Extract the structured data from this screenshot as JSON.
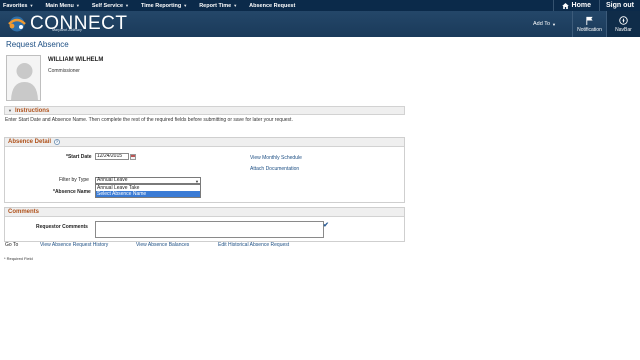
{
  "topnav": {
    "items": [
      {
        "label": "Favorites"
      },
      {
        "label": "Main Menu"
      },
      {
        "label": "Self Service"
      },
      {
        "label": "Time Reporting"
      },
      {
        "label": "Report Time"
      }
    ],
    "current": "Absence Request",
    "home_label": "Home",
    "signout_label": "Sign out"
  },
  "brand": {
    "logo_text": "CONNECT",
    "logo_sub": "Maryland Judiciary",
    "addto_label": "Add To",
    "notification_label": "Notification",
    "navbar_label": "NavBar"
  },
  "page": {
    "title": "Request Absence"
  },
  "employee": {
    "name": "WILLIAM WILHELM",
    "title": "Commissioner"
  },
  "instructions": {
    "heading": "Instructions",
    "text": "Enter Start Date and Absence Name. Then complete the rest of the required fields before submitting or save for later your request."
  },
  "absence_detail": {
    "heading": "Absence Detail",
    "start_date_label": "*Start Date",
    "start_date_value": "12/24/2015",
    "filter_label": "Filter by Type",
    "filter_value": "Annual Leave",
    "absence_name_label": "*Absence Name",
    "dropdown_options": [
      "Annual Leave Take",
      "Select Absence Name"
    ],
    "selected_option_index": 1,
    "link_schedule": "View Monthly Schedule",
    "link_attach": "Attach Documentation"
  },
  "comments": {
    "heading": "Comments",
    "requestor_label": "Requestor Comments",
    "requestor_value": ""
  },
  "goto": {
    "label": "Go To",
    "links": [
      "View Absence Request History",
      "View Absence Balances",
      "Edit Historical Absence Request"
    ]
  },
  "required_note": "* Required Field",
  "colors": {
    "nav_bg": "#0b2a4a",
    "brand_bg": "#1a3a5a",
    "section_heading": "#b0521b",
    "link": "#1d4f84",
    "dropdown_highlight": "#3a7bd5"
  }
}
